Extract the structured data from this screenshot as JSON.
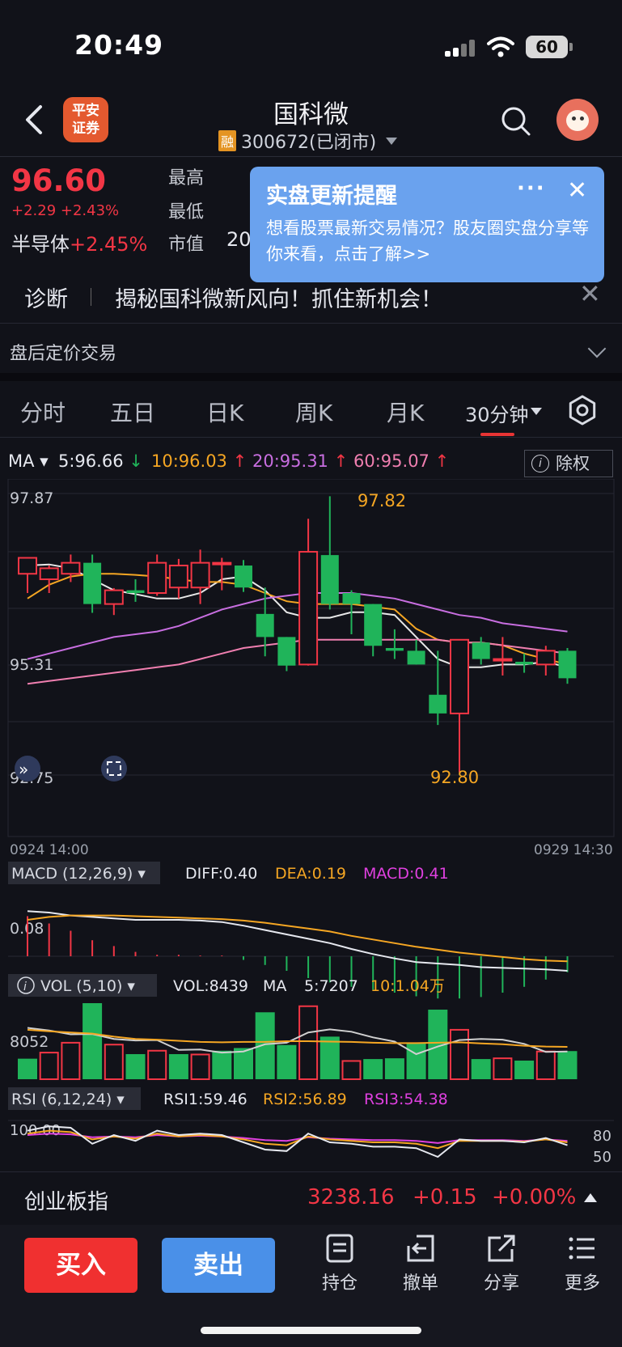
{
  "status": {
    "time": "20:49",
    "battery": "60"
  },
  "header": {
    "broker_logo_line1": "平安",
    "broker_logo_line2": "证券",
    "stock_name": "国科微",
    "rong_badge": "融",
    "code_status": "300672(已闭市)"
  },
  "quote": {
    "price": "96.60",
    "change": "+2.29 +2.43%",
    "sector_name": "半导体",
    "sector_change": "+2.45%",
    "label_high": "最高",
    "label_low": "最低",
    "label_mktcap": "市值",
    "mktcap_value_partial": "20"
  },
  "popup": {
    "title": "实盘更新提醒",
    "body": "想看股票最新交易情况？股友圈实盘分享等你来看，点击了解>>",
    "more": "···",
    "close": "✕"
  },
  "diagnosis": {
    "label": "诊断",
    "text": "揭秘国科微新风向！抓住新机会！",
    "close": "✕"
  },
  "afterhours": {
    "label": "盘后定价交易"
  },
  "tabs": [
    "分时",
    "五日",
    "日K",
    "周K",
    "月K"
  ],
  "tab_active": "30分钟",
  "ma": {
    "label": "MA",
    "ma5": "5:96.66",
    "ma10": "10:96.03",
    "ma20": "20:95.31",
    "ma60": "60:95.07",
    "chuquan": "除权",
    "colors": {
      "ma5": "#e8e8e8",
      "ma10": "#f5a623",
      "ma20": "#c86ee0",
      "ma60": "#f07fb0",
      "up": "#f23645",
      "down": "#20b45a"
    }
  },
  "chart_data": [
    {
      "type": "candlestick",
      "title": "",
      "y_ticks": [
        "97.87",
        "95.31",
        "92.75"
      ],
      "max_label": "97.82",
      "min_label": "92.80",
      "x_start": "0924 14:00",
      "x_end": "0929 14:30",
      "candles": [
        {
          "o": 96.41,
          "h": 96.56,
          "l": 96.06,
          "c": 96.7
        },
        {
          "o": 96.31,
          "h": 96.56,
          "l": 96.06,
          "c": 96.51
        },
        {
          "o": 96.41,
          "h": 96.76,
          "l": 96.26,
          "c": 96.61
        },
        {
          "o": 96.61,
          "h": 96.76,
          "l": 95.7,
          "c": 95.86
        },
        {
          "o": 95.86,
          "h": 96.15,
          "l": 95.66,
          "c": 96.11
        },
        {
          "o": 96.11,
          "h": 96.31,
          "l": 95.9,
          "c": 96.06
        },
        {
          "o": 96.06,
          "h": 96.76,
          "l": 96.01,
          "c": 96.61
        },
        {
          "o": 96.16,
          "h": 96.68,
          "l": 95.96,
          "c": 96.56
        },
        {
          "o": 96.16,
          "h": 96.85,
          "l": 95.86,
          "c": 96.61
        },
        {
          "o": 96.61,
          "h": 96.7,
          "l": 96.11,
          "c": 96.61
        },
        {
          "o": 96.56,
          "h": 96.66,
          "l": 96.08,
          "c": 96.16
        },
        {
          "o": 95.68,
          "h": 96.16,
          "l": 94.91,
          "c": 95.26
        },
        {
          "o": 95.26,
          "h": 95.26,
          "l": 94.64,
          "c": 94.74
        },
        {
          "o": 94.76,
          "h": 97.41,
          "l": 94.74,
          "c": 96.81
        },
        {
          "o": 96.75,
          "h": 97.82,
          "l": 95.76,
          "c": 95.86
        },
        {
          "o": 96.06,
          "h": 96.11,
          "l": 95.31,
          "c": 95.86
        },
        {
          "o": 95.86,
          "h": 95.86,
          "l": 94.91,
          "c": 95.1
        },
        {
          "o": 95.06,
          "h": 95.4,
          "l": 94.86,
          "c": 95.01
        },
        {
          "o": 95.01,
          "h": 95.21,
          "l": 94.76,
          "c": 94.76
        },
        {
          "o": 94.21,
          "h": 95.01,
          "l": 93.66,
          "c": 93.87
        },
        {
          "o": 93.87,
          "h": 95.21,
          "l": 92.8,
          "c": 95.21
        },
        {
          "o": 95.16,
          "h": 95.26,
          "l": 94.76,
          "c": 94.86
        },
        {
          "o": 94.86,
          "h": 95.26,
          "l": 94.56,
          "c": 94.86
        },
        {
          "o": 94.81,
          "h": 94.96,
          "l": 94.61,
          "c": 94.76
        },
        {
          "o": 94.76,
          "h": 95.1,
          "l": 94.56,
          "c": 95.01
        },
        {
          "o": 95.01,
          "h": 95.06,
          "l": 94.41,
          "c": 94.51
        }
      ],
      "ma_lines": {
        "ma5": [
          96.56,
          96.58,
          96.51,
          96.31,
          96.11,
          96.04,
          95.96,
          95.96,
          96.06,
          96.31,
          96.36,
          96.11,
          95.71,
          95.61,
          95.61,
          95.71,
          95.71,
          95.66,
          95.26,
          94.86,
          94.71,
          94.71,
          94.76,
          94.76,
          94.81,
          94.71
        ],
        "ma10": [
          95.96,
          96.21,
          96.36,
          96.41,
          96.41,
          96.39,
          96.36,
          96.31,
          96.26,
          96.26,
          96.21,
          96.06,
          95.91,
          95.86,
          95.86,
          95.86,
          95.81,
          95.76,
          95.41,
          95.21,
          95.16,
          95.16,
          95.11,
          94.96,
          94.86,
          94.76
        ],
        "ma20": [
          94.86,
          94.96,
          95.06,
          95.16,
          95.26,
          95.31,
          95.36,
          95.46,
          95.61,
          95.76,
          95.86,
          95.96,
          96.01,
          96.06,
          96.06,
          96.06,
          96.01,
          95.96,
          95.86,
          95.76,
          95.66,
          95.61,
          95.51,
          95.46,
          95.41,
          95.36
        ],
        "ma60": [
          94.41,
          94.46,
          94.51,
          94.56,
          94.61,
          94.66,
          94.71,
          94.76,
          94.86,
          94.96,
          95.06,
          95.11,
          95.16,
          95.21,
          95.21,
          95.21,
          95.21,
          95.21,
          95.21,
          95.21,
          95.16,
          95.16,
          95.11,
          95.06,
          95.01,
          94.96
        ]
      }
    },
    {
      "type": "macd",
      "indicator_label": "MACD (12,26,9)",
      "diff": "DIFF:0.40",
      "dea": "DEA:0.19",
      "macd": "MACD:0.41",
      "y_tick": "0.08",
      "hist": [
        0.55,
        0.45,
        0.35,
        0.22,
        0.14,
        0.06,
        0.02,
        0.02,
        0.01,
        0.01,
        -0.05,
        -0.12,
        -0.2,
        -0.3,
        -0.36,
        -0.42,
        -0.46,
        -0.5,
        -0.55,
        -0.58,
        -0.58,
        -0.56,
        -0.5,
        -0.42,
        -0.32,
        -0.22
      ],
      "diff_line": [
        0.62,
        0.6,
        0.56,
        0.54,
        0.52,
        0.5,
        0.5,
        0.5,
        0.49,
        0.47,
        0.42,
        0.36,
        0.3,
        0.24,
        0.18,
        0.1,
        0.03,
        -0.03,
        -0.08,
        -0.1,
        -0.12,
        -0.15,
        -0.16,
        -0.17,
        -0.18,
        -0.2
      ],
      "dea_line": [
        0.5,
        0.54,
        0.56,
        0.56,
        0.56,
        0.55,
        0.54,
        0.53,
        0.52,
        0.51,
        0.49,
        0.46,
        0.42,
        0.38,
        0.34,
        0.28,
        0.23,
        0.18,
        0.13,
        0.09,
        0.05,
        0.02,
        -0.01,
        -0.04,
        -0.06,
        -0.07
      ]
    },
    {
      "type": "volume",
      "indicator_label": "VOL (5,10)",
      "vol": "VOL:8439",
      "ma_label": "MA",
      "ma5": "5:7207",
      "ma10": "10:1.04万",
      "y_tick": "8052",
      "bars": [
        5400,
        7000,
        9600,
        20000,
        9100,
        6600,
        7500,
        6600,
        6500,
        7500,
        8200,
        17600,
        9000,
        19200,
        11200,
        4800,
        5300,
        5500,
        9500,
        18300,
        13000,
        5300,
        5500,
        4900,
        7300,
        7400
      ],
      "up": [
        false,
        true,
        true,
        false,
        true,
        false,
        true,
        false,
        true,
        false,
        false,
        false,
        false,
        true,
        false,
        true,
        false,
        false,
        false,
        false,
        true,
        false,
        true,
        false,
        true,
        false
      ],
      "ma5_line": [
        13500,
        12800,
        11800,
        11900,
        10600,
        10200,
        10300,
        7700,
        7800,
        7000,
        7300,
        9200,
        9600,
        12300,
        13100,
        12500,
        11000,
        9900,
        6600,
        8600,
        10300,
        10600,
        10400,
        9300,
        7200,
        7300
      ],
      "ma10_line": [
        13000,
        12600,
        12300,
        12000,
        11200,
        10600,
        10400,
        10100,
        9800,
        9700,
        9800,
        9800,
        10000,
        10000,
        9900,
        9800,
        9600,
        9500,
        9500,
        9600,
        9700,
        9400,
        9200,
        8800,
        8600,
        8500
      ]
    },
    {
      "type": "rsi",
      "indicator_label": "RSI (6,12,24)",
      "rsi1": "RSI1:59.46",
      "rsi2": "RSI2:56.89",
      "rsi3": "RSI3:54.38",
      "y_ticks": [
        "100.00",
        "80",
        "50"
      ],
      "rsi1_line": [
        66,
        72,
        70,
        48,
        60,
        52,
        66,
        60,
        62,
        60,
        50,
        40,
        38,
        62,
        50,
        48,
        44,
        44,
        42,
        30,
        54,
        52,
        52,
        50,
        56,
        46
      ],
      "rsi2_line": [
        62,
        66,
        64,
        54,
        58,
        55,
        62,
        58,
        60,
        58,
        54,
        48,
        46,
        58,
        54,
        52,
        50,
        50,
        48,
        42,
        52,
        52,
        52,
        51,
        54,
        50
      ],
      "rsi3_line": [
        60,
        62,
        61,
        57,
        58,
        57,
        60,
        58,
        59,
        58,
        56,
        53,
        52,
        57,
        55,
        54,
        53,
        53,
        52,
        49,
        53,
        53,
        53,
        52,
        54,
        52
      ]
    }
  ],
  "index": {
    "name": "创业板指",
    "value": "3238.16",
    "change": "+0.15",
    "pct": "+0.00%"
  },
  "actions": {
    "buy": "买入",
    "sell": "卖出",
    "position": "持仓",
    "cancel": "撤单",
    "share": "分享",
    "more": "更多"
  }
}
